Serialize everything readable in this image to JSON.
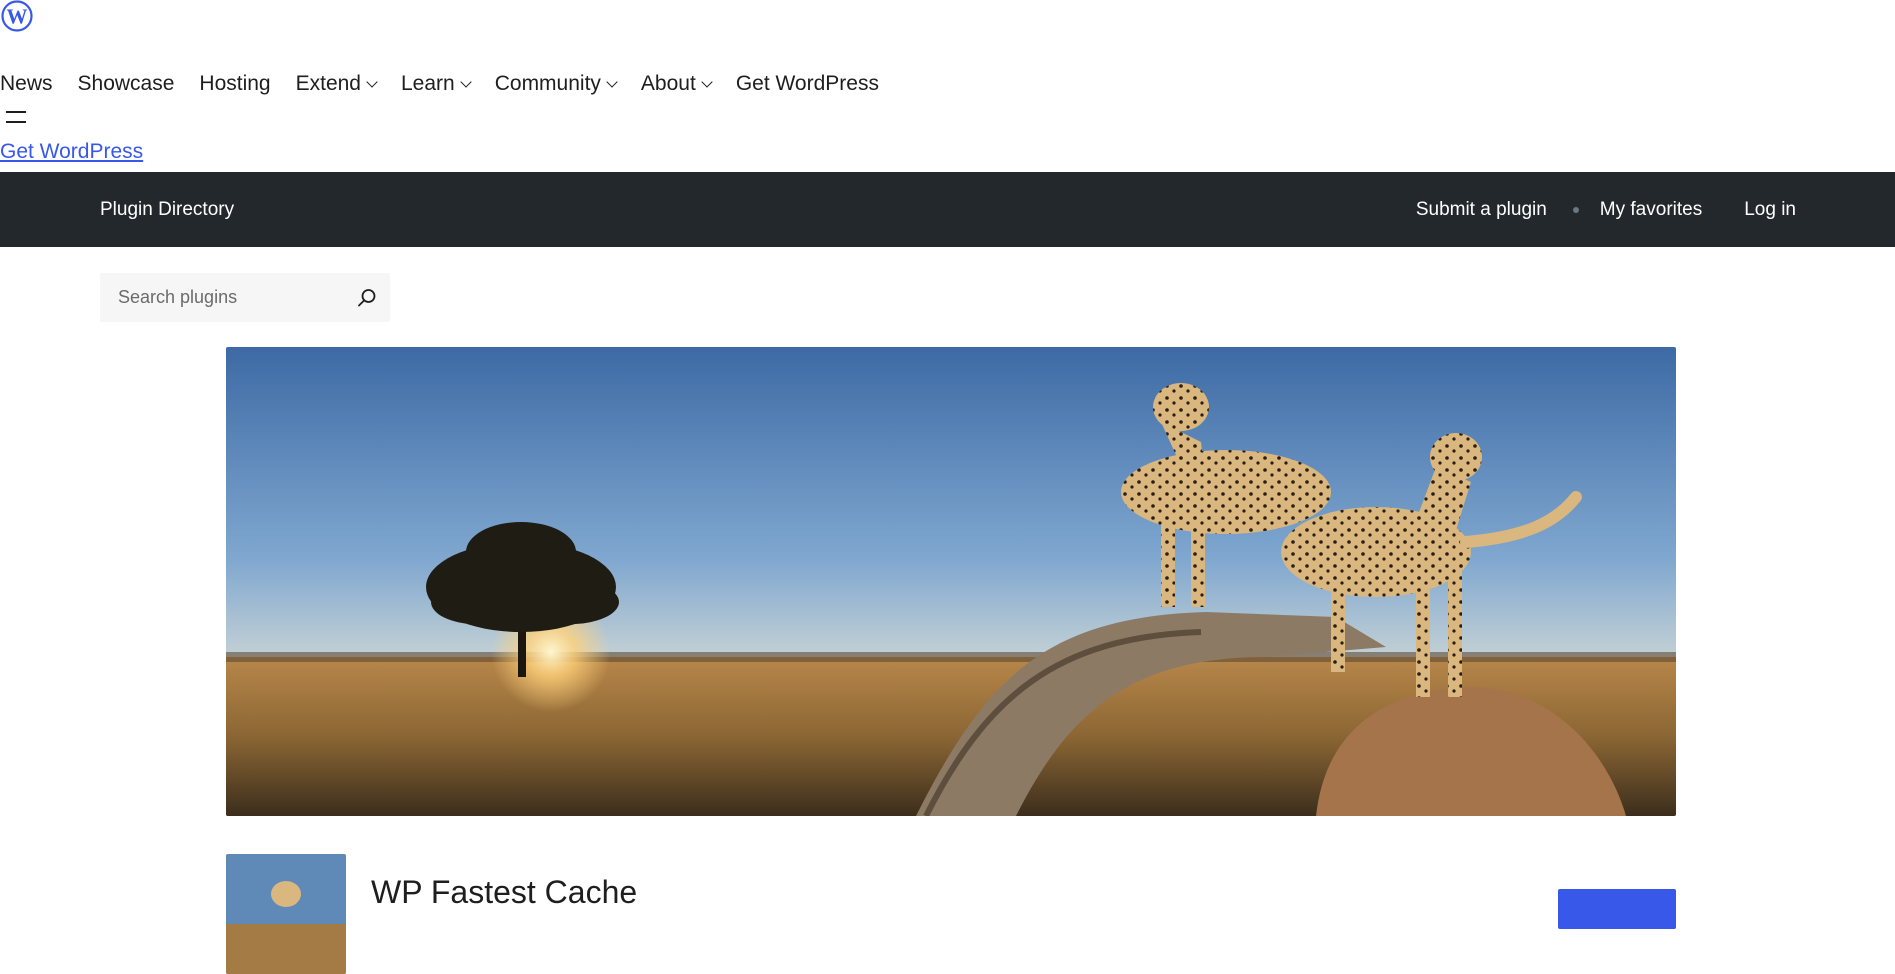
{
  "global_nav": {
    "logo_icon": "wordpress-logo-icon",
    "items": [
      {
        "label": "News",
        "dropdown": false
      },
      {
        "label": "Showcase",
        "dropdown": false
      },
      {
        "label": "Hosting",
        "dropdown": false
      },
      {
        "label": "Extend",
        "dropdown": true
      },
      {
        "label": "Learn",
        "dropdown": true
      },
      {
        "label": "Community",
        "dropdown": true
      },
      {
        "label": "About",
        "dropdown": true
      },
      {
        "label": "Get WordPress",
        "dropdown": false
      }
    ],
    "menu_icon": "hamburger-menu-icon",
    "get_wordpress_link": "Get WordPress"
  },
  "local_nav": {
    "title": "Plugin Directory",
    "links": {
      "submit": "Submit a plugin",
      "favorites": "My favorites",
      "login": "Log in"
    }
  },
  "search": {
    "placeholder": "Search plugins",
    "value": "",
    "icon": "search-icon"
  },
  "plugin": {
    "name": "WP Fastest Cache",
    "banner": "cheetah-savanna-banner"
  },
  "colors": {
    "accent": "#3858e9",
    "local_nav_bg": "#23282d",
    "search_bg": "#f6f6f6",
    "text": "#1e1e1e"
  }
}
